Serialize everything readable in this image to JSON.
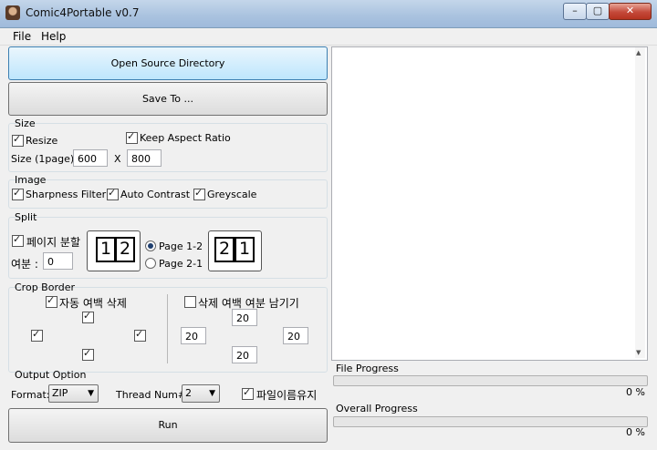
{
  "window": {
    "title": "Comic4Portable v0.7",
    "minimize": "–",
    "maximize": "▢",
    "close": "✕"
  },
  "menu": {
    "file": "File",
    "help": "Help"
  },
  "buttons": {
    "open": "Open Source Directory",
    "save": "Save To ...",
    "run": "Run"
  },
  "size": {
    "title": "Size",
    "resize_label": "Resize",
    "resize_checked": true,
    "keep_aspect_label": "Keep Aspect Ratio",
    "keep_aspect_checked": true,
    "size_label": "Size (1page):",
    "width": "600",
    "x": "X",
    "height": "800"
  },
  "image": {
    "title": "Image",
    "sharpness": "Sharpness Filter",
    "contrast": "Auto Contrast",
    "greyscale": "Greyscale"
  },
  "split": {
    "title": "Split",
    "split_label": "페이지 분할",
    "margin_label": "여분 :",
    "margin_value": "0",
    "left_pages": [
      "1",
      "2"
    ],
    "right_pages": [
      "2",
      "1"
    ],
    "page12": "Page 1-2",
    "page21": "Page 2-1",
    "selected": "Page 1-2"
  },
  "crop": {
    "title": "Crop Border",
    "auto_label": "자동 여백 삭제",
    "keep_label": "삭제 여백 여분 남기기",
    "top": "20",
    "left": "20",
    "right": "20",
    "bottom": "20"
  },
  "output": {
    "title": "Output Option",
    "format_label": "Format:",
    "format_value": "ZIP",
    "thread_label": "Thread Num#:",
    "thread_value": "2",
    "keep_name_label": "파일이름유지"
  },
  "progress": {
    "file_label": "File Progress",
    "file_pct": "0 %",
    "file_value": 0,
    "overall_label": "Overall Progress",
    "overall_pct": "0 %",
    "overall_value": 0
  },
  "colors": {
    "progress_fill": "#06b025",
    "title_bar": "#a9c2df",
    "close_button": "#c4493a"
  }
}
